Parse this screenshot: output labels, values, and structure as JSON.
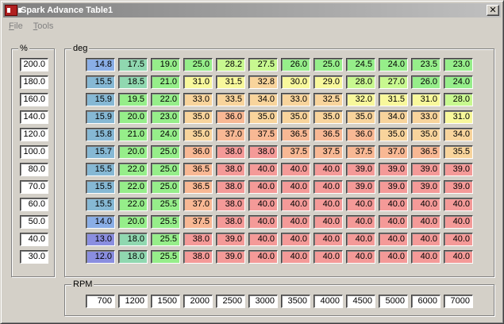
{
  "window": {
    "title": "Spark Advance Table1",
    "close_glyph": "✕"
  },
  "menu": {
    "file": {
      "accel": "F",
      "rest": "ile"
    },
    "tools": {
      "accel": "T",
      "rest": "ools"
    }
  },
  "left_group": {
    "label": "%"
  },
  "table_group": {
    "label": "deg"
  },
  "rpm_group": {
    "label": "RPM"
  },
  "load_values": [
    "200.0",
    "180.0",
    "160.0",
    "140.0",
    "120.0",
    "100.0",
    "80.0",
    "70.0",
    "60.0",
    "50.0",
    "40.0",
    "30.0"
  ],
  "rpm_values": [
    "700",
    "1200",
    "1500",
    "2000",
    "2500",
    "3000",
    "3500",
    "4000",
    "4500",
    "5000",
    "6000",
    "7000"
  ],
  "table": [
    [
      "14.8",
      "17.5",
      "19.0",
      "25.0",
      "28.2",
      "27.5",
      "26.0",
      "25.0",
      "24.5",
      "24.0",
      "23.5",
      "23.0"
    ],
    [
      "15.5",
      "18.5",
      "21.0",
      "31.0",
      "31.5",
      "32.8",
      "30.0",
      "29.0",
      "28.0",
      "27.0",
      "26.0",
      "24.0"
    ],
    [
      "15.9",
      "19.5",
      "22.0",
      "33.0",
      "33.5",
      "34.0",
      "33.0",
      "32.5",
      "32.0",
      "31.5",
      "31.0",
      "28.0"
    ],
    [
      "15.9",
      "20.0",
      "23.0",
      "35.0",
      "36.0",
      "35.0",
      "35.0",
      "35.0",
      "35.0",
      "34.0",
      "33.0",
      "31.0"
    ],
    [
      "15.8",
      "21.0",
      "24.0",
      "35.0",
      "37.0",
      "37.5",
      "36.5",
      "36.5",
      "36.0",
      "35.0",
      "35.0",
      "34.0"
    ],
    [
      "15.7",
      "20.0",
      "25.0",
      "36.0",
      "38.0",
      "38.0",
      "37.5",
      "37.5",
      "37.5",
      "37.0",
      "36.5",
      "35.5"
    ],
    [
      "15.5",
      "22.0",
      "25.0",
      "36.5",
      "38.0",
      "40.0",
      "40.0",
      "40.0",
      "39.0",
      "39.0",
      "39.0",
      "39.0"
    ],
    [
      "15.5",
      "22.0",
      "25.0",
      "36.5",
      "38.0",
      "40.0",
      "40.0",
      "40.0",
      "39.0",
      "39.0",
      "39.0",
      "39.0"
    ],
    [
      "15.5",
      "22.0",
      "25.5",
      "37.0",
      "38.0",
      "40.0",
      "40.0",
      "40.0",
      "40.0",
      "40.0",
      "40.0",
      "40.0"
    ],
    [
      "14.0",
      "20.0",
      "25.5",
      "37.5",
      "38.0",
      "40.0",
      "40.0",
      "40.0",
      "40.0",
      "40.0",
      "40.0",
      "40.0"
    ],
    [
      "13.0",
      "18.0",
      "25.5",
      "38.0",
      "39.0",
      "40.0",
      "40.0",
      "40.0",
      "40.0",
      "40.0",
      "40.0",
      "40.0"
    ],
    [
      "12.0",
      "18.0",
      "25.5",
      "38.0",
      "39.0",
      "40.0",
      "40.0",
      "40.0",
      "40.0",
      "40.0",
      "40.0",
      "40.0"
    ]
  ],
  "color_scale": [
    {
      "max": 13.5,
      "color": "#8a8ee0"
    },
    {
      "max": 15.0,
      "color": "#8aaee6"
    },
    {
      "max": 16.5,
      "color": "#86b8d4"
    },
    {
      "max": 18.9,
      "color": "#90d8b0"
    },
    {
      "max": 26.0,
      "color": "#96ee8a"
    },
    {
      "max": 28.5,
      "color": "#c8f890"
    },
    {
      "max": 32.0,
      "color": "#f8f89c"
    },
    {
      "max": 35.5,
      "color": "#f8d49c"
    },
    {
      "max": 37.9,
      "color": "#f8b894"
    },
    {
      "max": 99.0,
      "color": "#f49a98"
    }
  ]
}
